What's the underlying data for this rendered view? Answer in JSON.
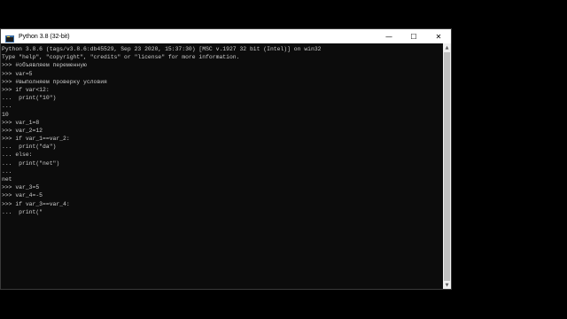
{
  "window": {
    "title": "Python 3.8 (32-bit)",
    "minimize_glyph": "—",
    "maximize_glyph": "☐",
    "close_glyph": "✕",
    "icon": "python-icon"
  },
  "scrollbar": {
    "up_glyph": "▲",
    "down_glyph": "▼"
  },
  "console": {
    "lines": [
      "Python 3.8.6 (tags/v3.8.6:db45529, Sep 23 2020, 15:37:30) [MSC v.1927 32 bit (Intel)] on win32",
      "Type \"help\", \"copyright\", \"credits\" or \"license\" for more information.",
      ">>> #объявляем переменную",
      ">>> var=5",
      ">>> #выполняем проверку условия",
      ">>> if var<12:",
      "...  print(\"10\")",
      "...",
      "10",
      ">>> var_1=8",
      ">>> var_2=12",
      ">>> if var_1==var_2:",
      "...  print(\"da\")",
      "... else:",
      "...  print(\"net\")",
      "...",
      "net",
      ">>> var_3=5",
      ">>> var_4=-5",
      ">>> if var_3==var_4:",
      "...  print(\""
    ]
  },
  "colors": {
    "console_bg": "#0c0c0c",
    "console_text": "#cccccc",
    "titlebar_bg": "#ffffff"
  }
}
